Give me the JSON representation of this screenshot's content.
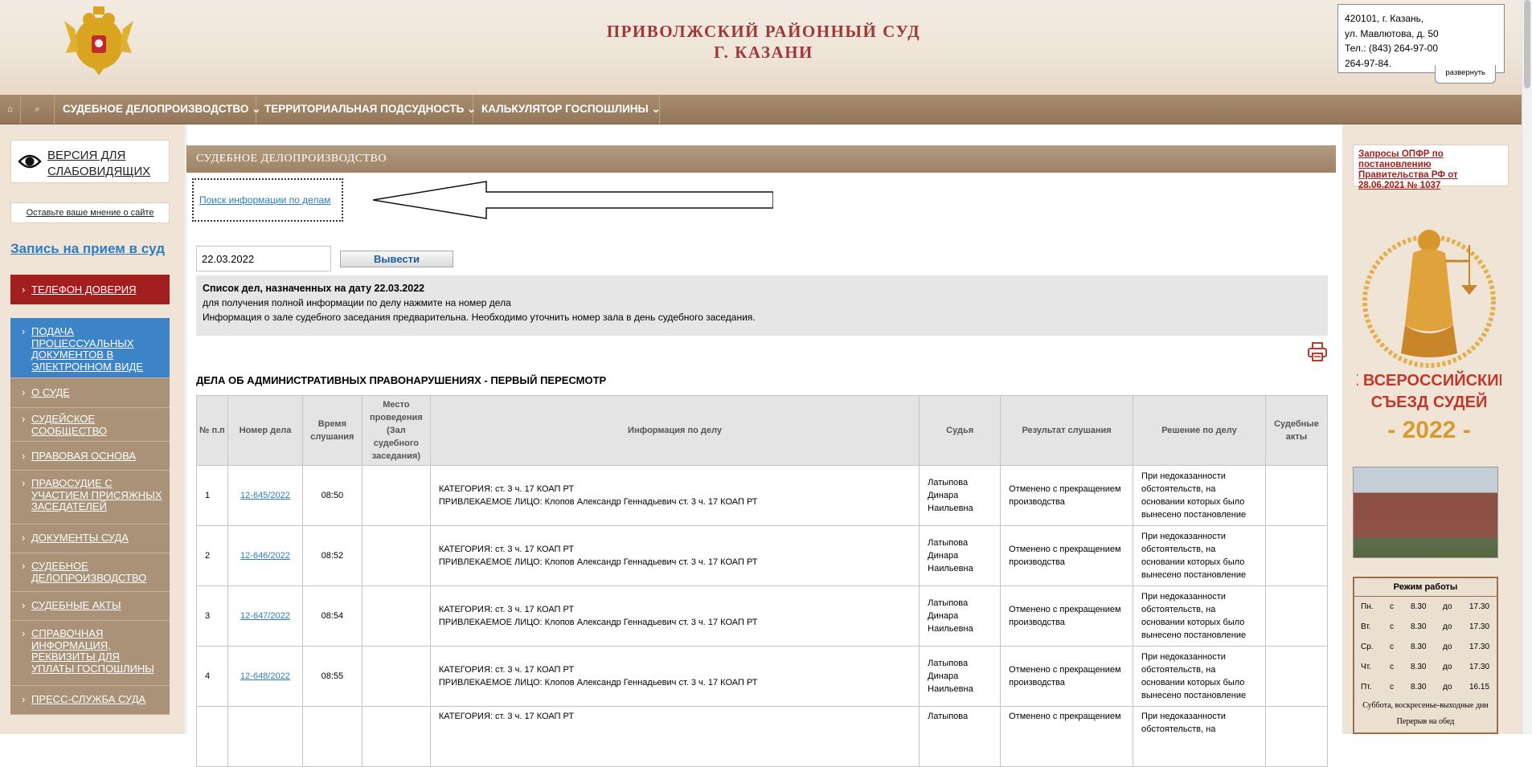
{
  "header": {
    "title_line1": "ПРИВОЛЖСКИЙ РАЙОННЫЙ СУД",
    "title_line2": "Г. КАЗАНИ",
    "address": [
      "420101, г. Казань,",
      "ул. Мавлютова, д. 50",
      "Тел.: (843) 264-97-00",
      "264-97-84."
    ],
    "expand_label": "развернуть"
  },
  "nav": {
    "home_icon": "⌂",
    "search_icon": "⌕",
    "items": [
      "СУДЕБНОЕ ДЕЛОПРОИЗВОДСТВО ⌄",
      "ТЕРРИТОРИАЛЬНАЯ ПОДСУДНОСТЬ ⌄",
      "КАЛЬКУЛЯТОР ГОСПОШЛИНЫ ⌄"
    ]
  },
  "sidebar": {
    "vision_line1": "ВЕРСИЯ ДЛЯ",
    "vision_line2": "СЛАБОВИДЯЩИХ",
    "feedback": "Оставьте ваше мнение о сайте",
    "appointment": "Запись на прием в суд",
    "hotline": "ТЕЛЕФОН ДОВЕРИЯ",
    "menu": [
      "ПОДАЧА ПРОЦЕССУАЛЬНЫХ ДОКУМЕНТОВ В ЭЛЕКТРОННОМ ВИДЕ",
      "О СУДЕ",
      "СУДЕЙСКОЕ СООБЩЕСТВО",
      "ПРАВОВАЯ ОСНОВА",
      "ПРАВОСУДИЕ С УЧАСТИЕМ ПРИСЯЖНЫХ ЗАСЕДАТЕЛЕЙ",
      "ДОКУМЕНТЫ СУДА",
      "СУДЕБНОЕ ДЕЛОПРОИЗВОДСТВО",
      "СУДЕБНЫЕ АКТЫ",
      "СПРАВОЧНАЯ ИНФОРМАЦИЯ, РЕКВИЗИТЫ ДЛЯ УПЛАТЫ ГОСПОШЛИНЫ",
      "ПРЕСС-СЛУЖБА СУДА"
    ]
  },
  "main": {
    "section_header": "СУДЕБНОЕ ДЕЛОПРОИЗВОДСТВО",
    "search_link": "Поиск информации по делам",
    "date_value": "22.03.2022",
    "show_button": "Вывести",
    "info_title": "Список дел, назначенных на дату 22.03.2022",
    "info_line1": "для получения полной информации по делу нажмите на номер дела",
    "info_line2": "Информация о зале судебного заседания предварительна. Необходимо уточнить номер зала в день судебного заседания.",
    "case_section_title": "ДЕЛА ОБ АДМИНИСТРАТИВНЫХ ПРАВОНАРУШЕНИЯХ - ПЕРВЫЙ ПЕРЕСМОТР"
  },
  "table": {
    "headers": {
      "num": "№ п.п",
      "case_number": "Номер дела",
      "time": "Время слушания",
      "place": "Место проведения (Зал судебного заседания)",
      "info": "Информация по делу",
      "judge": "Судья",
      "result": "Результат слушания",
      "decision": "Решение по делу",
      "acts": "Судебные акты"
    },
    "rows": [
      {
        "num": "1",
        "case": "12-645/2022",
        "time": "08:50",
        "place": "",
        "category": "КАТЕГОРИЯ: ст. 3 ч. 17 КОАП РТ",
        "person": "ПРИВЛЕКАЕМОЕ ЛИЦО: Клопов Александр Геннадьевич ст. 3 ч. 17 КОАП РТ",
        "judge": "Латыпова Динара Наильевна",
        "result": "Отменено с прекращением производства",
        "decision": "При недоказанности обстоятельств, на основании которых было вынесено постановление",
        "acts": ""
      },
      {
        "num": "2",
        "case": "12-646/2022",
        "time": "08:52",
        "place": "",
        "category": "КАТЕГОРИЯ: ст. 3 ч. 17 КОАП РТ",
        "person": "ПРИВЛЕКАЕМОЕ ЛИЦО: Клопов Александр Геннадьевич ст. 3 ч. 17 КОАП РТ",
        "judge": "Латыпова Динара Наильевна",
        "result": "Отменено с прекращением производства",
        "decision": "При недоказанности обстоятельств, на основании которых было вынесено постановление",
        "acts": ""
      },
      {
        "num": "3",
        "case": "12-647/2022",
        "time": "08:54",
        "place": "",
        "category": "КАТЕГОРИЯ: ст. 3 ч. 17 КОАП РТ",
        "person": "ПРИВЛЕКАЕМОЕ ЛИЦО: Клопов Александр Геннадьевич ст. 3 ч. 17 КОАП РТ",
        "judge": "Латыпова Динара Наильевна",
        "result": "Отменено с прекращением производства",
        "decision": "При недоказанности обстоятельств, на основании которых было вынесено постановление",
        "acts": ""
      },
      {
        "num": "4",
        "case": "12-648/2022",
        "time": "08:55",
        "place": "",
        "category": "КАТЕГОРИЯ: ст. 3 ч. 17 КОАП РТ",
        "person": "ПРИВЛЕКАЕМОЕ ЛИЦО: Клопов Александр Геннадьевич ст. 3 ч. 17 КОАП РТ",
        "judge": "Латыпова Динара Наильевна",
        "result": "Отменено с прекращением производства",
        "decision": "При недоказанности обстоятельств, на основании которых было вынесено постановление",
        "acts": ""
      },
      {
        "num": "",
        "case": "",
        "time": "",
        "place": "",
        "category": "КАТЕГОРИЯ: ст. 3 ч. 17 КОАП РТ",
        "person": "",
        "judge": "Латыпова",
        "result": "Отменено с прекращением",
        "decision": "При недоказанности обстоятельств, на",
        "acts": ""
      }
    ]
  },
  "right": {
    "opfr_link": "Запросы ОПФР по постановлению Правительства РФ от 28.06.2021 № 1037",
    "congress_line1": "X ВСЕРОССИЙСКИЙ",
    "congress_line2": "СЪЕЗД СУДЕЙ",
    "congress_year": "- 2022 -",
    "hours_title": "Режим работы",
    "hours": [
      {
        "day": "Пн.",
        "from_word": "с",
        "from": "8.30",
        "to_word": "до",
        "to": "17.30"
      },
      {
        "day": "Вт.",
        "from_word": "с",
        "from": "8.30",
        "to_word": "до",
        "to": "17.30"
      },
      {
        "day": "Ср.",
        "from_word": "с",
        "from": "8.30",
        "to_word": "до",
        "to": "17.30"
      },
      {
        "day": "Чт.",
        "from_word": "с",
        "from": "8.30",
        "to_word": "до",
        "to": "17.30"
      },
      {
        "day": "Пт.",
        "from_word": "с",
        "from": "8.30",
        "to_word": "до",
        "to": "16.15"
      }
    ],
    "hours_note1": "Суббота, воскресенье-выходные дни",
    "hours_note2": "Перерыв на обед"
  },
  "colors": {
    "title_red": "#a03838",
    "nav_brown": "#a88d6f",
    "link_blue": "#2a7dc2",
    "hotline_red": "#a31e1e",
    "menu_blue": "#3d83c8",
    "menu_brown": "#a99277"
  }
}
